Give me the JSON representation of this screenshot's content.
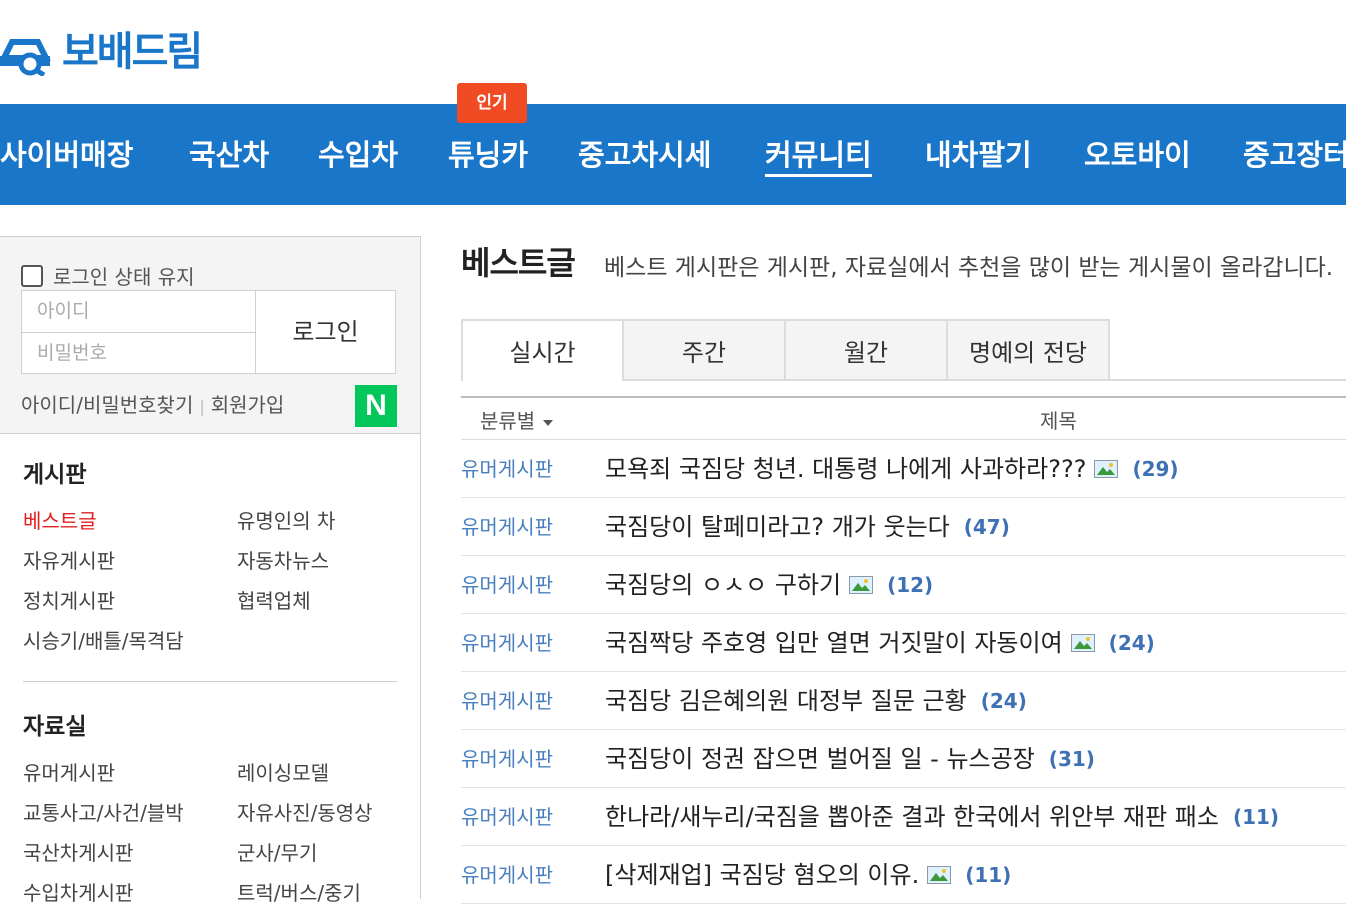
{
  "logo": {
    "text": "보배드림"
  },
  "nav": {
    "badge": "인기",
    "items": [
      {
        "label": "사이버매장"
      },
      {
        "label": "국산차"
      },
      {
        "label": "수입차"
      },
      {
        "label": "튜닝카"
      },
      {
        "label": "중고차시세"
      },
      {
        "label": "커뮤니티"
      },
      {
        "label": "내차팔기"
      },
      {
        "label": "오토바이"
      },
      {
        "label": "중고장터"
      }
    ]
  },
  "login": {
    "keep_label": "로그인 상태 유지",
    "id_placeholder": "아이디",
    "pw_placeholder": "비밀번호",
    "login_button": "로그인",
    "find_link": "아이디/비밀번호찾기",
    "separator": "|",
    "join_link": "회원가입",
    "naver_label": "N"
  },
  "board": {
    "title": "게시판",
    "items": [
      "베스트글",
      "유명인의 차",
      "자유게시판",
      "자동차뉴스",
      "정치게시판",
      "협력업체",
      "시승기/배틀/목격담"
    ]
  },
  "archive": {
    "title": "자료실",
    "items": [
      "유머게시판",
      "레이싱모델",
      "교통사고/사건/블박",
      "자유사진/동영상",
      "국산차게시판",
      "군사/무기",
      "수입차게시판",
      "트럭/버스/중기"
    ]
  },
  "content": {
    "title": "베스트글",
    "desc": "베스트 게시판은 게시판, 자료실에서 추천을 많이 받는 게시물이 올라갑니다.",
    "tabs": [
      "실시간",
      "주간",
      "월간",
      "명예의 전당"
    ],
    "columns": {
      "category": "분류별",
      "subject": "제목"
    },
    "rows": [
      {
        "category": "유머게시판",
        "title": "모욕죄 국짐당 청년. 대통령 나에게 사과하라???",
        "image": true,
        "count": "(29)"
      },
      {
        "category": "유머게시판",
        "title": "국짐당이 탈페미라고? 개가 웃는다",
        "image": false,
        "count": "(47)"
      },
      {
        "category": "유머게시판",
        "title": "국짐당의 ㅇㅅㅇ 구하기",
        "image": true,
        "count": "(12)"
      },
      {
        "category": "유머게시판",
        "title": "국짐짝당 주호영 입만 열면 거짓말이 자동이여",
        "image": true,
        "count": "(24)"
      },
      {
        "category": "유머게시판",
        "title": "국짐당 김은혜의원 대정부 질문 근황",
        "image": false,
        "count": "(24)"
      },
      {
        "category": "유머게시판",
        "title": "국짐당이 정권 잡으면 벌어질 일 - 뉴스공장",
        "image": false,
        "count": "(31)"
      },
      {
        "category": "유머게시판",
        "title": "한나라/새누리/국짐을 뽑아준 결과 한국에서 위안부 재판 패소",
        "image": false,
        "count": "(11)"
      },
      {
        "category": "유머게시판",
        "title": "[삭제재업] 국짐당 혐오의 이유.",
        "image": true,
        "count": "(11)"
      }
    ]
  },
  "colors": {
    "brand": "#1a76c9",
    "badge": "#f14b23",
    "naver": "#03c75a",
    "active_menu": "#e02020",
    "count": "#3e70b4"
  }
}
